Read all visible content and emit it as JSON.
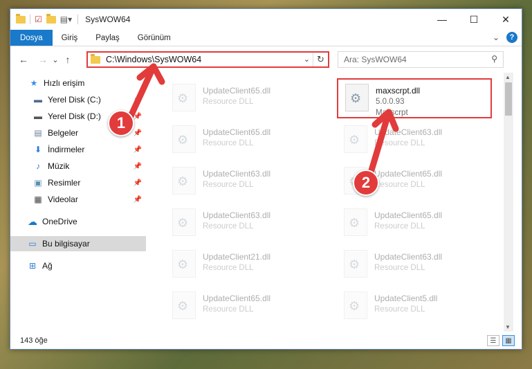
{
  "window": {
    "title": "SysWOW64",
    "minimize_glyph": "—",
    "maximize_glyph": "☐",
    "close_glyph": "✕"
  },
  "ribbon": {
    "tabs": [
      "Dosya",
      "Giriş",
      "Paylaş",
      "Görünüm"
    ],
    "expand_glyph": "⌄",
    "help_glyph": "?"
  },
  "nav": {
    "back_glyph": "←",
    "forward_glyph": "→",
    "recent_glyph": "⌄",
    "up_glyph": "↑"
  },
  "address": {
    "path": "C:\\Windows\\SysWOW64",
    "dropdown_glyph": "⌄",
    "refresh_glyph": "↻"
  },
  "search": {
    "placeholder": "Ara: SysWOW64",
    "icon_glyph": "⚲"
  },
  "navpane": {
    "items": [
      {
        "label": "Hızlı erişim",
        "icon": "star-icon",
        "glyph": "★",
        "color": "#3a8ee6",
        "pinned": false
      },
      {
        "label": "Yerel Disk (C:)",
        "icon": "drive-icon",
        "glyph": "▬",
        "color": "#4a6d8c",
        "pinned": true
      },
      {
        "label": "Yerel Disk (D:)",
        "icon": "drive-icon",
        "glyph": "▬",
        "color": "#555555",
        "pinned": true
      },
      {
        "label": "Belgeler",
        "icon": "documents-icon",
        "glyph": "▤",
        "color": "#6b7f99",
        "pinned": true
      },
      {
        "label": "İndirmeler",
        "icon": "download-icon",
        "glyph": "⬇",
        "color": "#2b7bd4",
        "pinned": true
      },
      {
        "label": "Müzik",
        "icon": "music-icon",
        "glyph": "♪",
        "color": "#2b7bd4",
        "pinned": true
      },
      {
        "label": "Resimler",
        "icon": "pictures-icon",
        "glyph": "▣",
        "color": "#5a8fb0",
        "pinned": true
      },
      {
        "label": "Videolar",
        "icon": "video-icon",
        "glyph": "▦",
        "color": "#444444",
        "pinned": true
      },
      {
        "label": "OneDrive",
        "icon": "cloud-icon",
        "glyph": "☁",
        "color": "#1979ca",
        "pinned": false
      },
      {
        "label": "Bu bilgisayar",
        "icon": "computer-icon",
        "glyph": "▭",
        "color": "#2b7bd4",
        "pinned": false
      },
      {
        "label": "Ağ",
        "icon": "network-icon",
        "glyph": "⊞",
        "color": "#2b7bd4",
        "pinned": false
      }
    ],
    "pin_glyph": "📌"
  },
  "files": [
    {
      "name": "UpdateClient65.dll",
      "sub1": "Resource DLL",
      "sub2": "",
      "col": 0,
      "row": 0,
      "faded": true
    },
    {
      "name": "maxscrpt.dll",
      "sub1": "5.0.0.93",
      "sub2": "Maxscrpt",
      "col": 1,
      "row": 0,
      "faded": false,
      "highlight": true
    },
    {
      "name": "UpdateClient65.dll",
      "sub1": "Resource DLL",
      "sub2": "",
      "col": 0,
      "row": 1,
      "faded": true
    },
    {
      "name": "UpdateClient63.dll",
      "sub1": "Resource DLL",
      "sub2": "",
      "col": 1,
      "row": 1,
      "faded": true
    },
    {
      "name": "UpdateClient63.dll",
      "sub1": "Resource DLL",
      "sub2": "",
      "col": 0,
      "row": 2,
      "faded": true
    },
    {
      "name": "UpdateClient65.dll",
      "sub1": "Resource DLL",
      "sub2": "",
      "col": 1,
      "row": 2,
      "faded": true
    },
    {
      "name": "UpdateClient63.dll",
      "sub1": "Resource DLL",
      "sub2": "",
      "col": 0,
      "row": 3,
      "faded": true
    },
    {
      "name": "UpdateClient65.dll",
      "sub1": "Resource DLL",
      "sub2": "",
      "col": 1,
      "row": 3,
      "faded": true
    },
    {
      "name": "UpdateClient21.dll",
      "sub1": "Resource DLL",
      "sub2": "",
      "col": 0,
      "row": 4,
      "faded": true
    },
    {
      "name": "UpdateClient63.dll",
      "sub1": "Resource DLL",
      "sub2": "",
      "col": 1,
      "row": 4,
      "faded": true
    },
    {
      "name": "UpdateClient65.dll",
      "sub1": "Resource DLL",
      "sub2": "",
      "col": 0,
      "row": 5,
      "faded": true
    },
    {
      "name": "UpdateClient5.dll",
      "sub1": "Resource DLL",
      "sub2": "",
      "col": 1,
      "row": 5,
      "faded": true
    }
  ],
  "status": {
    "count": "143 öğe",
    "details_view_glyph": "☰",
    "tiles_view_glyph": "▦"
  },
  "annotations": {
    "badge1": "1",
    "badge2": "2",
    "color": "#e23b3b"
  }
}
